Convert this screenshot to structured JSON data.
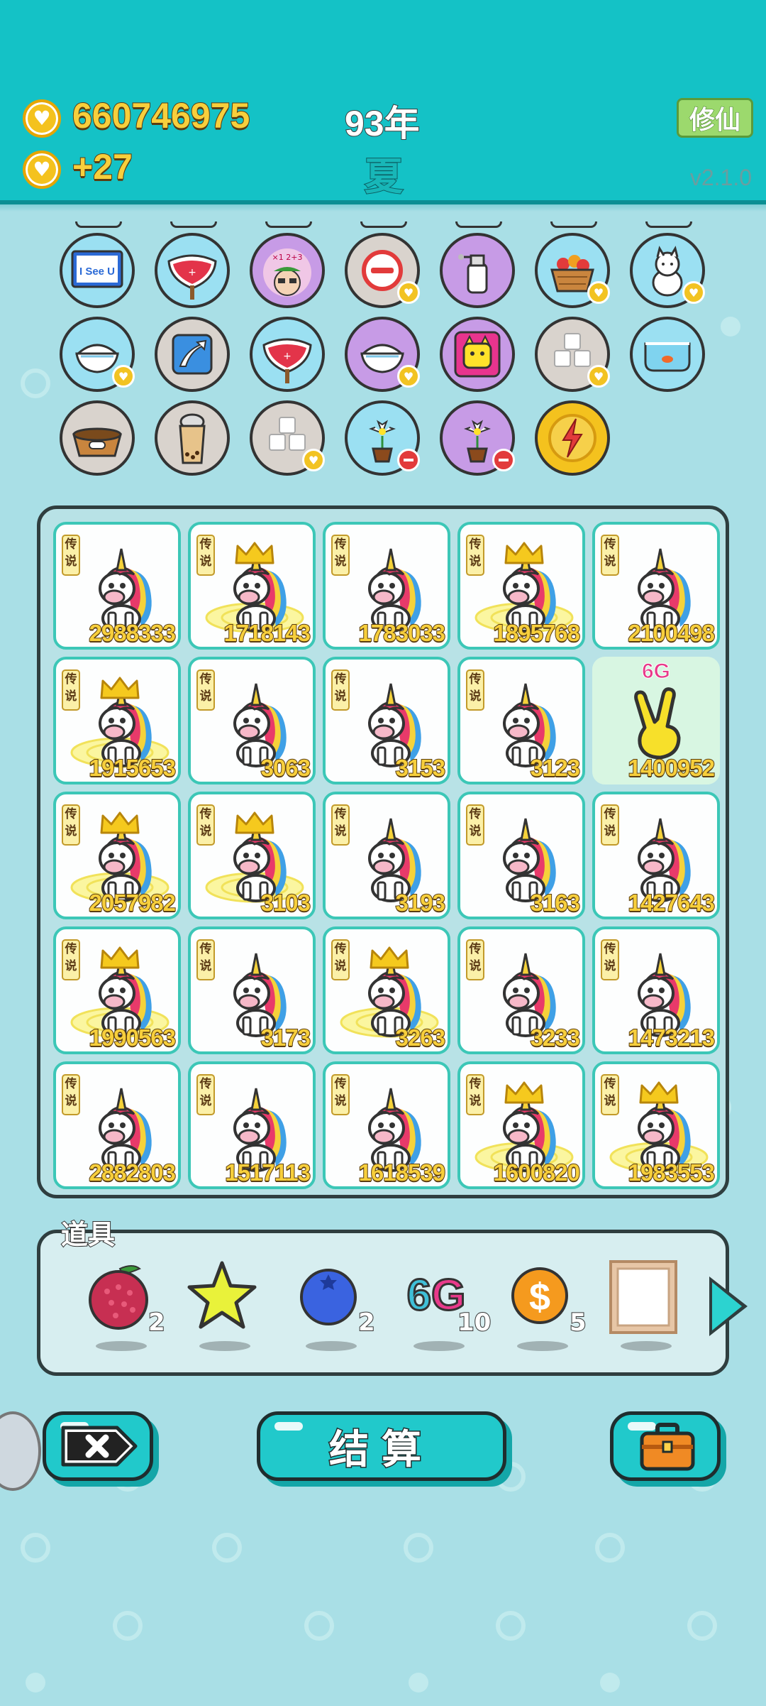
{
  "header": {
    "coins": "660746975",
    "income": "+27",
    "year": "93年",
    "season": "夏",
    "cultivate_button": "修仙",
    "version": "v2.1.0"
  },
  "colors": {
    "header_bg": "#14c2c6",
    "background": "#a9dfe6",
    "gold_text": "#f7cf3c",
    "cell_border": "#3cc7b7"
  },
  "item_icons": [
    {
      "icon": "i-see-u-sign-icon",
      "label": "I See U",
      "bg": "blue",
      "badge": "none"
    },
    {
      "icon": "heart-fan-icon",
      "bg": "blue",
      "badge": "none"
    },
    {
      "icon": "math-genius-icon",
      "bg": "purple",
      "badge": "none"
    },
    {
      "icon": "no-entry-icon",
      "bg": "grey",
      "badge": "heart"
    },
    {
      "icon": "spray-bottle-icon",
      "bg": "purple",
      "badge": "none"
    },
    {
      "icon": "fruit-basket-icon",
      "bg": "blue",
      "badge": "heart"
    },
    {
      "icon": "white-dog-icon",
      "bg": "blue",
      "badge": "heart"
    },
    {
      "icon": "rice-bowl-icon",
      "bg": "blue",
      "badge": "heart"
    },
    {
      "icon": "upgrade-arrow-icon",
      "bg": "grey",
      "badge": "none"
    },
    {
      "icon": "heart-fan-icon",
      "bg": "blue",
      "badge": "none"
    },
    {
      "icon": "rice-bowl-icon",
      "bg": "purple",
      "badge": "heart"
    },
    {
      "icon": "yellow-creature-icon",
      "bg": "purple",
      "badge": "none"
    },
    {
      "icon": "sugar-cubes-icon",
      "bg": "grey",
      "badge": "heart"
    },
    {
      "icon": "fish-tank-icon",
      "bg": "blue",
      "badge": "none"
    },
    {
      "icon": "dog-bowl-icon",
      "bg": "grey",
      "badge": "none"
    },
    {
      "icon": "bubble-tea-icon",
      "bg": "grey",
      "badge": "none"
    },
    {
      "icon": "sugar-cubes-icon",
      "bg": "grey",
      "badge": "heart"
    },
    {
      "icon": "potted-flower-icon",
      "bg": "blue",
      "badge": "minus"
    },
    {
      "icon": "potted-flower-icon",
      "bg": "purple",
      "badge": "minus"
    },
    {
      "icon": "lightning-icon",
      "bg": "gold",
      "badge": "none"
    }
  ],
  "board": {
    "legend_tag": "传说",
    "special_label": "6G",
    "cells": [
      {
        "value": "2988333",
        "crown": false
      },
      {
        "value": "1718143",
        "crown": true
      },
      {
        "value": "1783033",
        "crown": false
      },
      {
        "value": "1895768",
        "crown": true
      },
      {
        "value": "2100498",
        "crown": false
      },
      {
        "value": "1915653",
        "crown": true
      },
      {
        "value": "3063",
        "crown": false
      },
      {
        "value": "3153",
        "crown": false
      },
      {
        "value": "3123",
        "crown": false
      },
      {
        "value": "1400952",
        "special": true
      },
      {
        "value": "2057982",
        "crown": true
      },
      {
        "value": "3103",
        "crown": true
      },
      {
        "value": "3193",
        "crown": false
      },
      {
        "value": "3163",
        "crown": false
      },
      {
        "value": "1427643",
        "crown": false
      },
      {
        "value": "1990563",
        "crown": true
      },
      {
        "value": "3173",
        "crown": false
      },
      {
        "value": "3263",
        "crown": true
      },
      {
        "value": "3233",
        "crown": false
      },
      {
        "value": "1473213",
        "crown": false
      },
      {
        "value": "2882803",
        "crown": false
      },
      {
        "value": "1517113",
        "crown": false
      },
      {
        "value": "1618539",
        "crown": false
      },
      {
        "value": "1600820",
        "crown": true
      },
      {
        "value": "1983553",
        "crown": true
      }
    ]
  },
  "props": {
    "label": "道具",
    "items": [
      {
        "icon": "lychee-icon",
        "count": "2"
      },
      {
        "icon": "star-icon",
        "count": ""
      },
      {
        "icon": "blueberry-icon",
        "count": "2"
      },
      {
        "icon": "6g-icon",
        "text": "6G",
        "count": "10"
      },
      {
        "icon": "dollar-coin-icon",
        "count": "5"
      },
      {
        "icon": "blank-frame-icon",
        "count": ""
      }
    ]
  },
  "bottom": {
    "settle_label": "结算"
  }
}
